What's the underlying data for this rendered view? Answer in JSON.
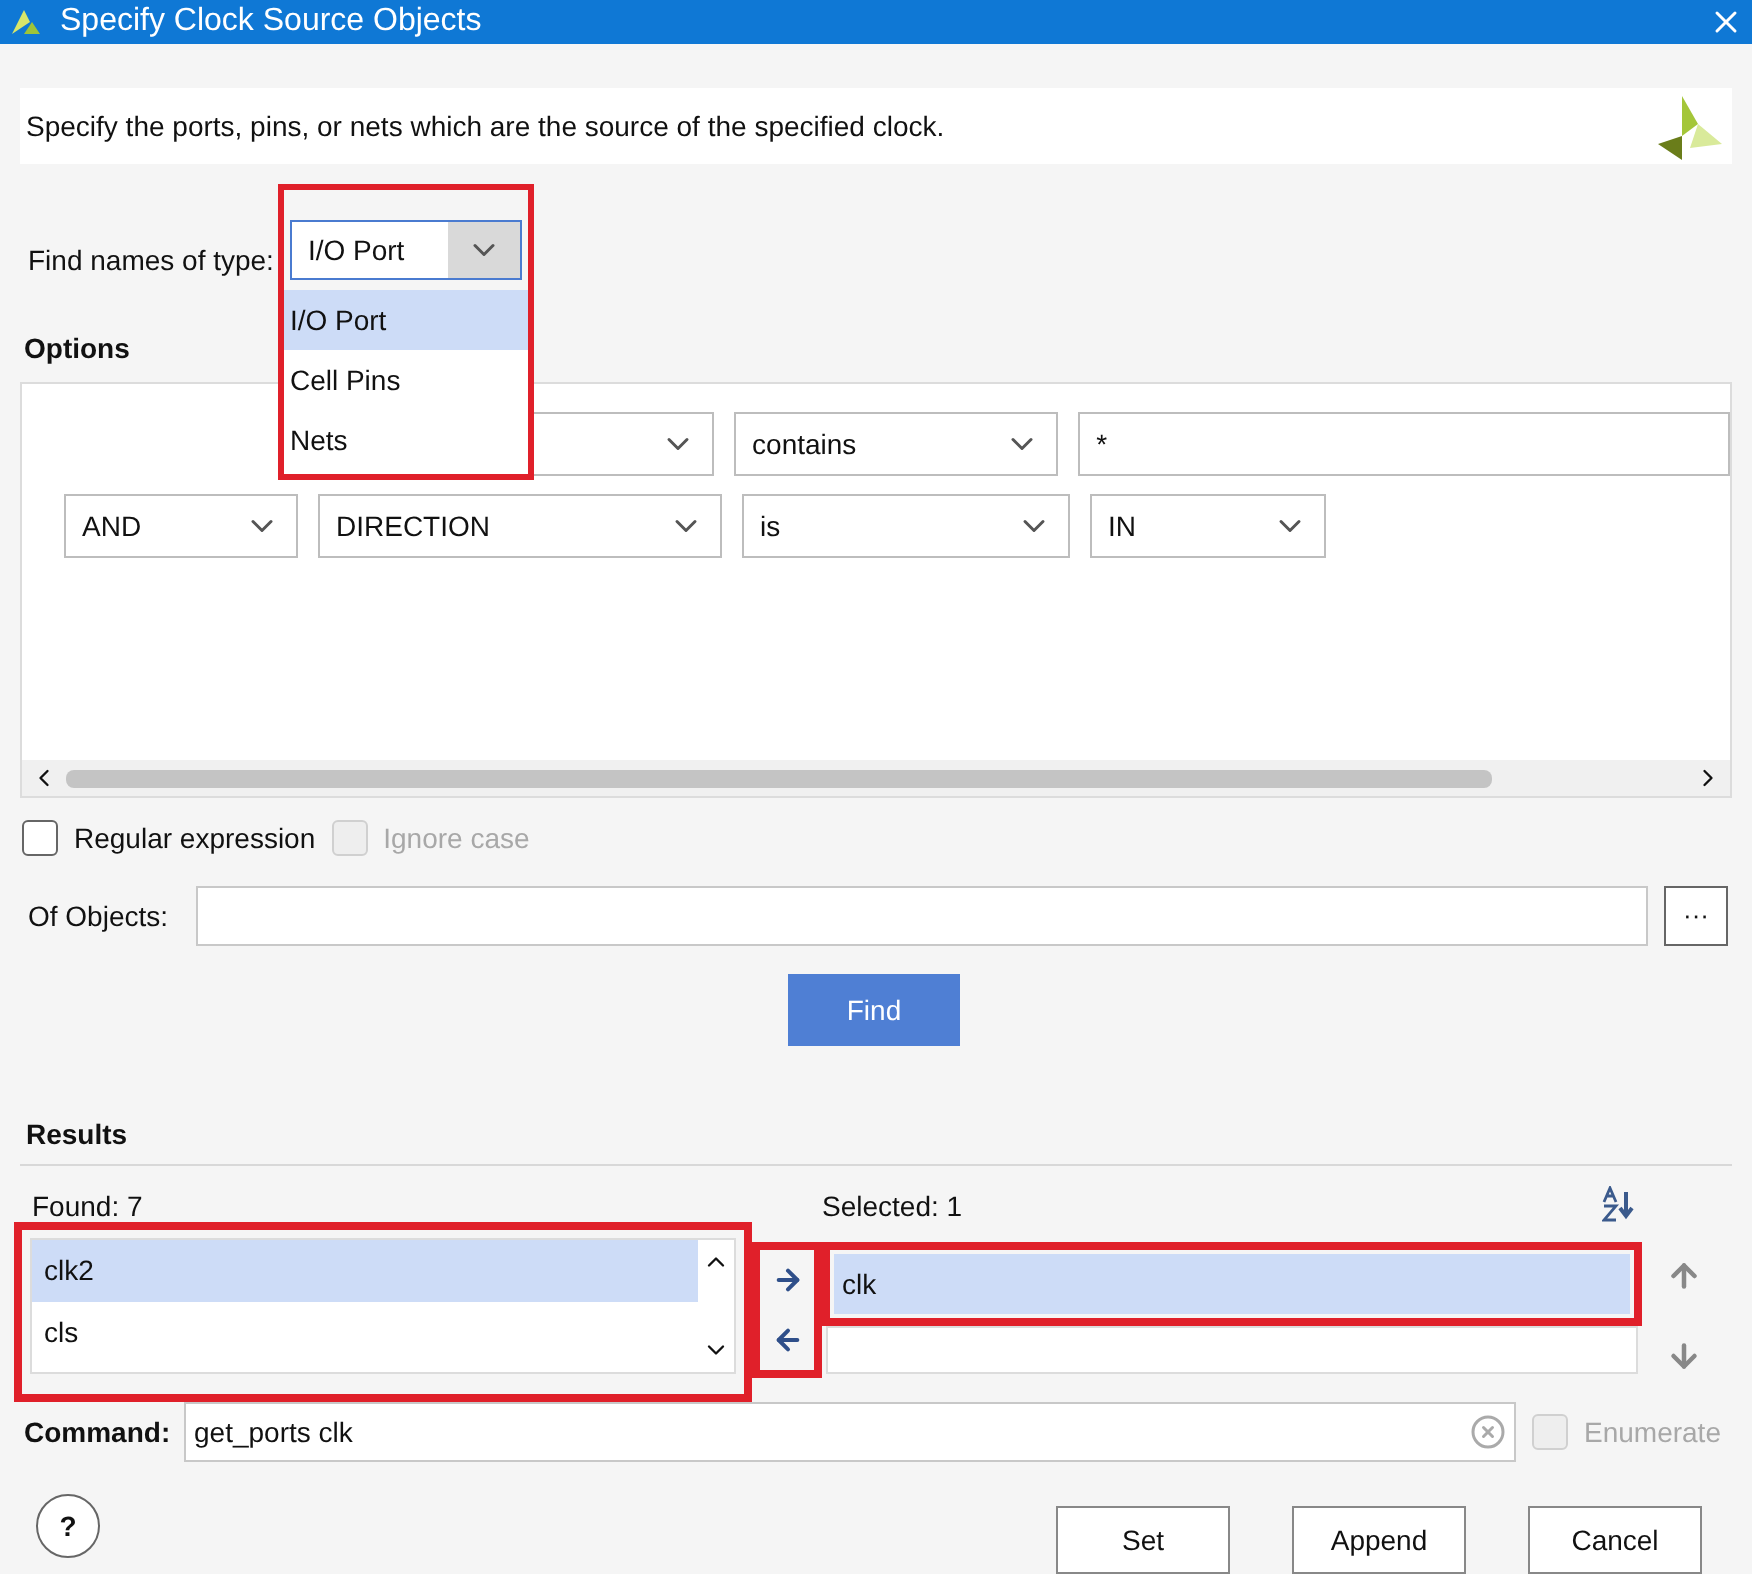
{
  "window": {
    "title": "Specify Clock Source Objects"
  },
  "description": "Specify the ports, pins, or nets which are the source of the specified clock.",
  "find_type": {
    "label": "Find names of type:",
    "value": "I/O Port",
    "expanded": true,
    "options": [
      {
        "label": "I/O Port",
        "selected": true
      },
      {
        "label": "Cell Pins",
        "selected": false
      },
      {
        "label": "Nets",
        "selected": false
      }
    ]
  },
  "options": {
    "title": "Options",
    "rows": [
      {
        "column_1": "",
        "column_2": "",
        "column_3": "contains",
        "column_4": "*",
        "kind": "text"
      },
      {
        "column_1": "AND",
        "column_2": "DIRECTION",
        "column_3": "is",
        "column_4": "IN",
        "kind": "select"
      }
    ]
  },
  "regular_expression": {
    "label": "Regular expression",
    "checked": false,
    "disabled": false
  },
  "ignore_case": {
    "label": "Ignore case",
    "checked": false,
    "disabled": true
  },
  "of_objects": {
    "label": "Of Objects:",
    "browse": "···"
  },
  "find_button": "Find",
  "results": {
    "title": "Results",
    "found": "Found: 7",
    "selected_label": "Selected: 1",
    "found_items": [
      {
        "label": "clk2",
        "selected": true
      },
      {
        "label": "cls",
        "selected": false
      }
    ],
    "selected_items": [
      {
        "label": "clk",
        "selected": true
      }
    ]
  },
  "command": {
    "label": "Command:",
    "value": "get_ports clk"
  },
  "enumerate": {
    "label": "Enumerate",
    "checked": false,
    "disabled": true
  },
  "help": "?",
  "buttons": [
    "Set",
    "Append",
    "Cancel"
  ]
}
